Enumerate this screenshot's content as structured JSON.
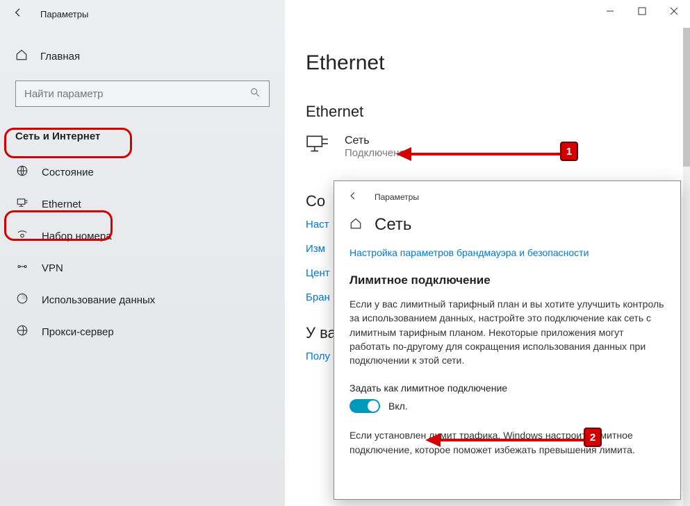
{
  "titlebar": {
    "title": "Параметры"
  },
  "sidebar": {
    "home": "Главная",
    "search_placeholder": "Найти параметр",
    "category": "Сеть и Интернет",
    "items": [
      {
        "label": "Состояние"
      },
      {
        "label": "Ethernet"
      },
      {
        "label": "Набор номера"
      },
      {
        "label": "VPN"
      },
      {
        "label": "Использование данных"
      },
      {
        "label": "Прокси-сервер"
      }
    ]
  },
  "main": {
    "title": "Ethernet",
    "section": "Ethernet",
    "network": {
      "name": "Сеть",
      "status": "Подключено"
    },
    "related_heading_partial": "Со",
    "links": [
      "Наст",
      "Изм",
      "Цент",
      "Бран"
    ],
    "question_heading_partial": "У ва",
    "help_link_partial": "Полу"
  },
  "popup": {
    "title": "Параметры",
    "heading": "Сеть",
    "firewall_link": "Настройка параметров брандмауэра и безопасности",
    "metered_heading": "Лимитное подключение",
    "metered_desc": "Если у вас лимитный тарифный план и вы хотите улучшить контроль за использованием данных, настройте это подключение как сеть с лимитным тарифным планом. Некоторые приложения могут работать по-другому для сокращения использования данных при подключении к этой сети.",
    "toggle_label": "Задать как лимитное подключение",
    "toggle_state": "Вкл.",
    "note": "Если установлен лимит трафика, Windows настроит лимитное подключение, которое поможет избежать превышения лимита."
  },
  "annotations": {
    "badge1": "1",
    "badge2": "2"
  }
}
